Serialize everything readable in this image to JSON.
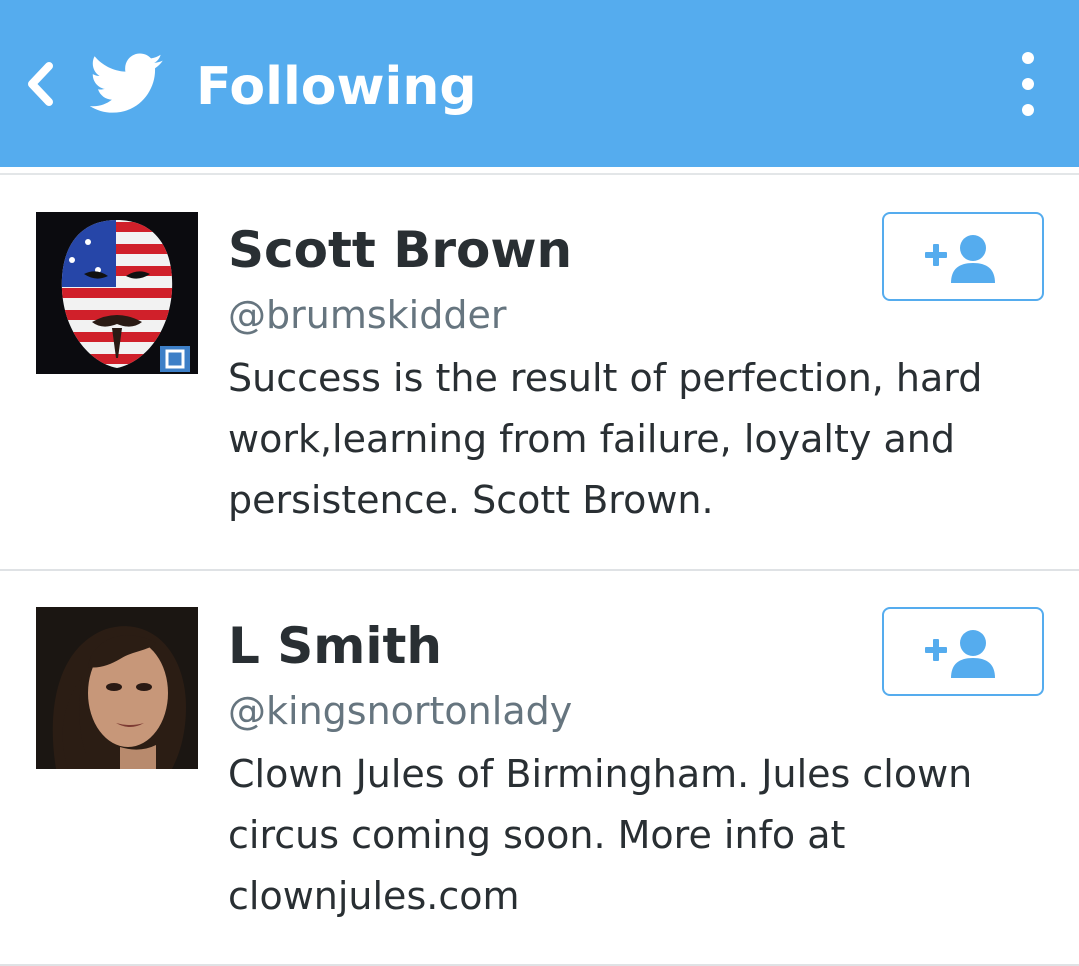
{
  "header": {
    "title": "Following",
    "back_icon": "chevron-left-icon",
    "logo_icon": "twitter-bird-icon",
    "overflow_icon": "more-vertical-icon",
    "background_color": "#55acee"
  },
  "users": [
    {
      "name": "Scott Brown",
      "handle": "@brumskidder",
      "bio": "Success is the result of perfection, hard work,learning from failure, loyalty and persistence. Scott Brown.",
      "avatar": "mask-avatar-image",
      "follow_icon": "add-user-icon"
    },
    {
      "name": "L Smith",
      "handle": "@kingsnortonlady",
      "bio": "Clown Jules of Birmingham. Jules clown circus coming soon. More info at clownjules.com",
      "avatar": "woman-portrait-avatar-image",
      "follow_icon": "add-user-icon"
    }
  ],
  "colors": {
    "accent": "#55acee",
    "name_text": "#292f33",
    "handle_text": "#66757f",
    "divider": "#dfe2e5"
  }
}
